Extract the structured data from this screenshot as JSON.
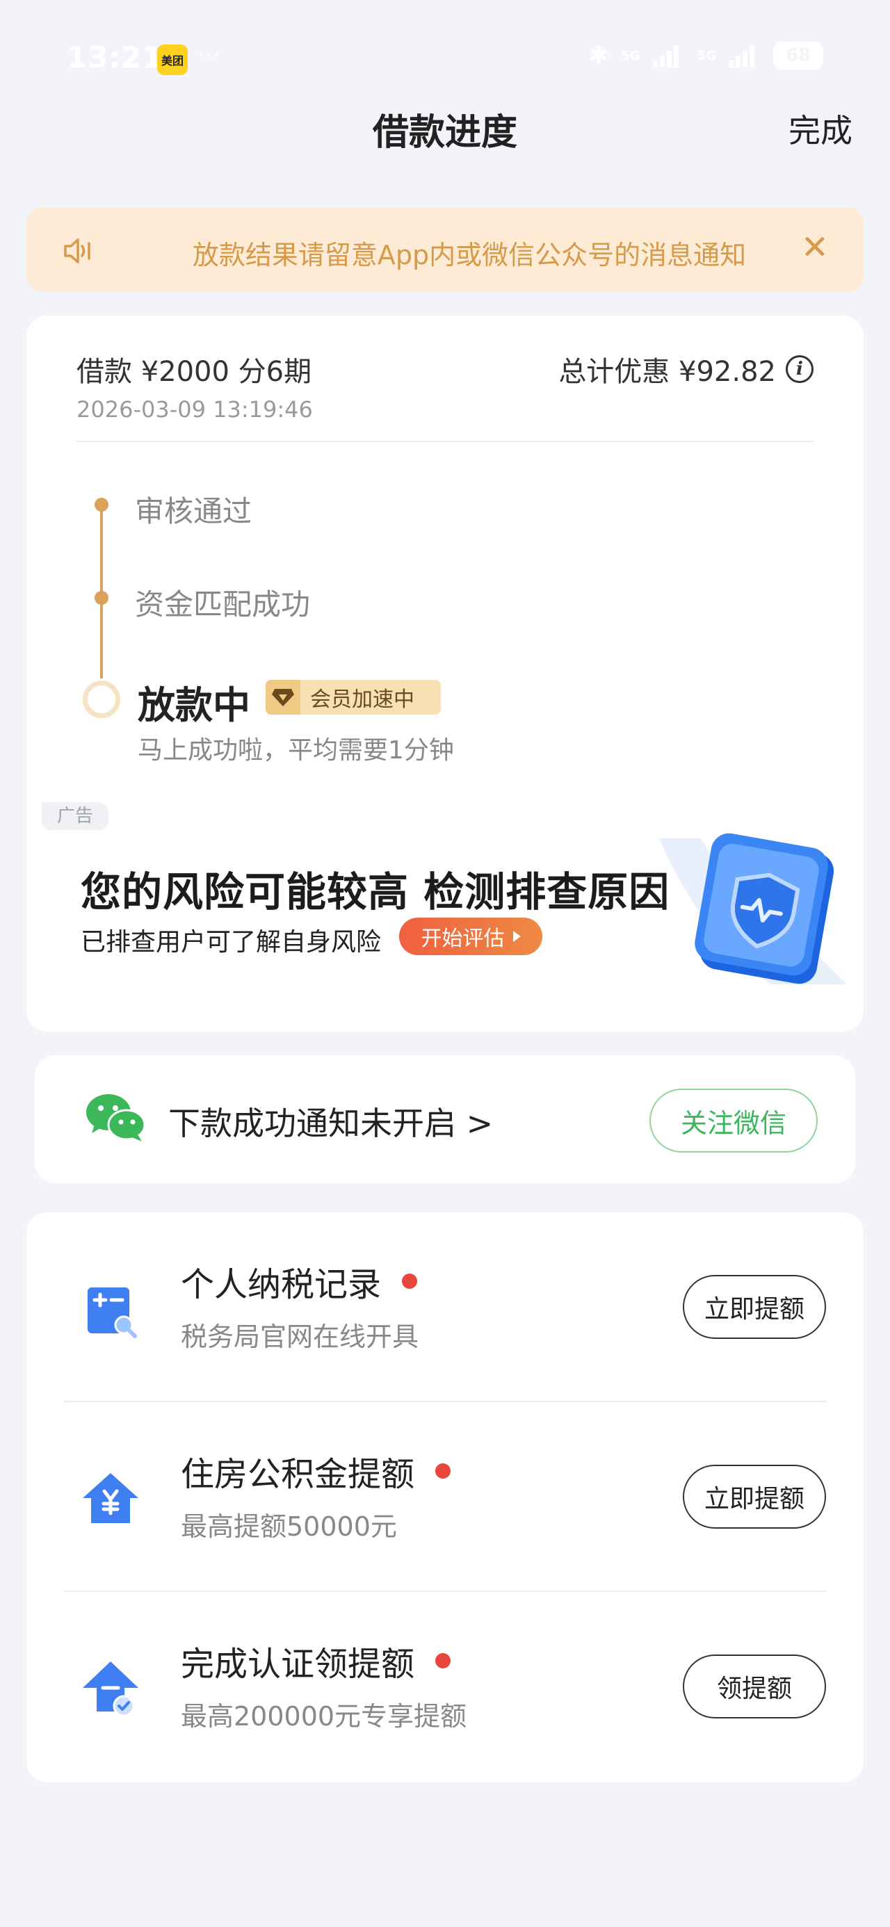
{
  "status_bar": {
    "time": "13:21",
    "app_badge": "美团",
    "more": "···",
    "signal_1": "5G",
    "signal_2": "5G",
    "battery": "68"
  },
  "nav": {
    "title": "借款进度",
    "done_label": "完成"
  },
  "notice": {
    "text": "放款结果请留意App内或微信公众号的消息通知",
    "speaker_icon": "speaker-icon",
    "close_glyph": "✕"
  },
  "loan": {
    "amount_text": "借款 ¥2000   分6期",
    "datetime": "2026-03-09 13:19:46",
    "discount_text": "总计优惠 ¥92.82",
    "info_glyph": "i"
  },
  "timeline": {
    "steps": [
      {
        "label": "审核通过",
        "state": "done"
      },
      {
        "label": "资金匹配成功",
        "state": "done"
      },
      {
        "label": "放款中",
        "state": "current"
      }
    ],
    "vip_badge": "会员加速中",
    "current_sub": "马上成功啦，平均需要1分钟",
    "accent_color": "#d9a35b"
  },
  "ad": {
    "tag": "广告",
    "title": "您的风险可能较高 检测排查原因",
    "subtitle": "已排查用户可了解自身风险",
    "button_label": "开始评估"
  },
  "wechat": {
    "text": "下款成功通知未开启 >",
    "button_label": "关注微信",
    "brand_color": "#3cb85a"
  },
  "list": {
    "items": [
      {
        "title": "个人纳税记录",
        "subtitle": "税务局官网在线开具",
        "button": "立即提额",
        "icon": "calculator-search-icon"
      },
      {
        "title": "住房公积金提额",
        "subtitle": "最高提额50000元",
        "button": "立即提额",
        "icon": "house-yuan-icon"
      },
      {
        "title": "完成认证领提额",
        "subtitle": "最高200000元专享提额",
        "button": "领提额",
        "icon": "arrow-up-check-icon"
      }
    ]
  }
}
